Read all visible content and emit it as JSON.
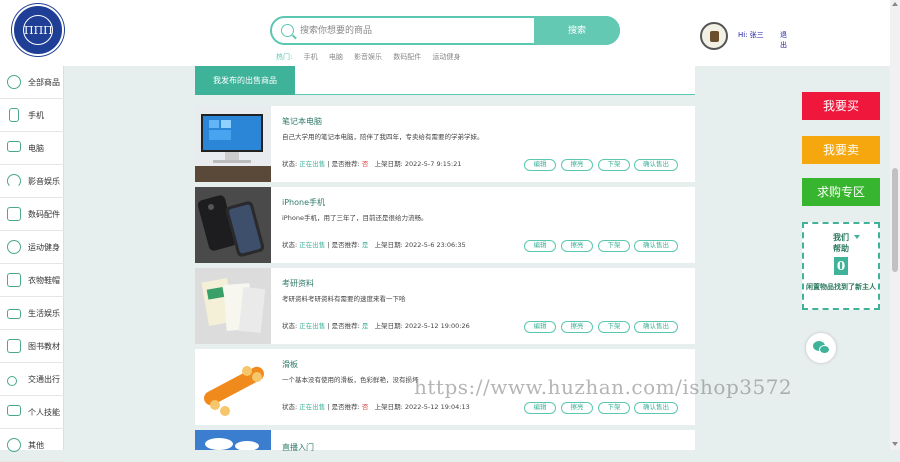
{
  "header": {
    "logo_text": "ΠΠΠ",
    "search": {
      "placeholder": "搜索你想要的商品",
      "button_label": "搜索"
    },
    "hot": {
      "label": "热门:",
      "items": [
        "手机",
        "电脑",
        "影音娱乐",
        "数码配件",
        "运动健身"
      ]
    },
    "user": {
      "greeting": "Hi: 张三",
      "logout": "退出"
    }
  },
  "sidebar": {
    "items": [
      {
        "label": "全部商品",
        "icon": "plus-circle-icon"
      },
      {
        "label": "手机",
        "icon": "phone-icon"
      },
      {
        "label": "电脑",
        "icon": "monitor-icon"
      },
      {
        "label": "影音娱乐",
        "icon": "headphones-icon"
      },
      {
        "label": "数码配件",
        "icon": "camera-icon"
      },
      {
        "label": "运动健身",
        "icon": "ball-icon"
      },
      {
        "label": "衣物鞋帽",
        "icon": "shirt-icon"
      },
      {
        "label": "生活娱乐",
        "icon": "radio-icon"
      },
      {
        "label": "图书教材",
        "icon": "book-icon"
      },
      {
        "label": "交通出行",
        "icon": "scooter-icon"
      },
      {
        "label": "个人技能",
        "icon": "tv-icon"
      },
      {
        "label": "其他",
        "icon": "plus-circle-icon"
      }
    ]
  },
  "main": {
    "tab_label": "我发布的出售商品",
    "labels": {
      "status": "状态:",
      "recommend": "是否推荐:",
      "date": "上架日期:"
    },
    "buttons": [
      "编辑",
      "擦亮",
      "下架",
      "确认售出"
    ],
    "items": [
      {
        "title": "笔记本电脑",
        "desc": "自己大学用的笔记本电脑，陪伴了我四年，专卖给有需要的学弟学妹。",
        "status": "正在出售",
        "recommend": "否",
        "date": "2022-5-7 9:15:21"
      },
      {
        "title": "iPhone手机",
        "desc": "iPhone手机，用了三年了，目前还是很给力流畅。",
        "status": "正在出售",
        "recommend": "是",
        "date": "2022-5-6 23:06:35"
      },
      {
        "title": "考研资料",
        "desc": "考研资料考研资料有需要的速度来看一下哈",
        "status": "正在出售",
        "recommend": "是",
        "date": "2022-5-12 19:00:26"
      },
      {
        "title": "滑板",
        "desc": "一个基本没有使用的滑板，色彩鲜艳，没有损坏",
        "status": "正在出售",
        "recommend": "否",
        "date": "2022-5-12 19:04:13"
      },
      {
        "title": "直播入门",
        "desc": "",
        "status": "",
        "recommend": "",
        "date": ""
      }
    ]
  },
  "right_panel": {
    "buy": "我要买",
    "sell": "我要卖",
    "request": "求购专区",
    "help_title_1": "我们",
    "help_title_2": "帮助",
    "help_count": "0",
    "help_text": "闲置物品找到了新主人",
    "colors": {
      "buy": "#f0173c",
      "sell": "#f5a70d",
      "request": "#38b52e"
    }
  },
  "watermark": "https://www.huzhan.com/ishop3572"
}
